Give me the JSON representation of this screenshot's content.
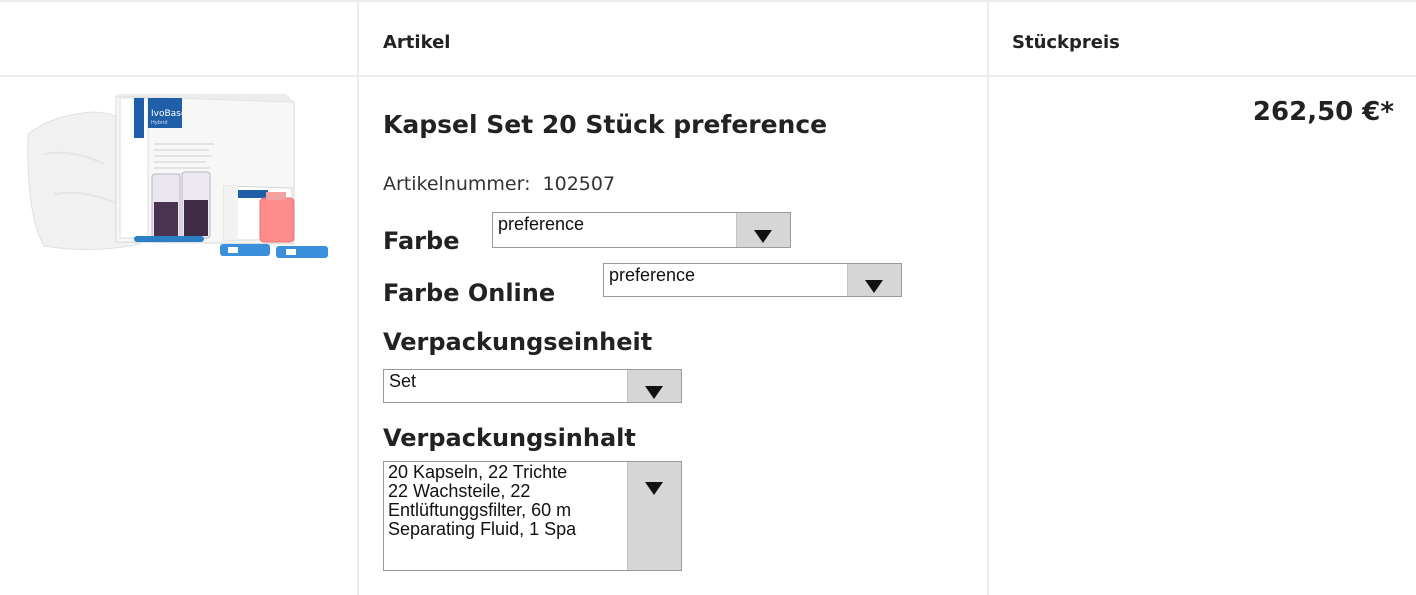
{
  "table": {
    "col_article": "Artikel",
    "col_unit_price": "Stückpreis"
  },
  "product": {
    "image_alt": "IvoBase Hybrid Kapsel Set",
    "title": "Kapsel Set 20 Stück preference",
    "article_number_label": "Artikelnummer:",
    "article_number": "102507",
    "price": "262,50 €*"
  },
  "options": {
    "color": {
      "label": "Farbe",
      "selected": "preference"
    },
    "color_online": {
      "label": "Farbe Online",
      "selected": "preference"
    },
    "package_unit": {
      "label": "Verpackungseinheit",
      "selected": "Set"
    },
    "package_content": {
      "label": "Verpackungsinhalt",
      "lines": [
        "20 Kapseln, 22 Trichte",
        "22 Wachsteile, 22",
        "Entlüftunggsfilter, 60 m",
        "Separating Fluid, 1 Spa"
      ]
    }
  },
  "colors": {
    "accent_box": "#1f5fa8",
    "fluid": "#ff8c8c",
    "border": "#ececec"
  }
}
